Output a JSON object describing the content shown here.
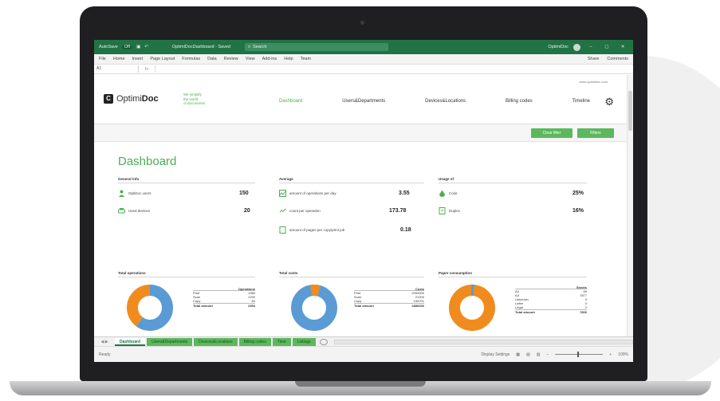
{
  "titlebar": {
    "autosave": "AutoSave",
    "autosave_state": "Off",
    "doc_title": "OptimiDocDashboard - Saved",
    "search_placeholder": "Search",
    "user": "OptimiDoc",
    "minimize": "–",
    "restore": "▢",
    "close": "✕"
  },
  "menubar": {
    "items": [
      "File",
      "Home",
      "Insert",
      "Page Layout",
      "Formulas",
      "Data",
      "Review",
      "View",
      "Add-ins",
      "Help",
      "Team"
    ],
    "share": "Share",
    "comments": "Comments"
  },
  "formulabar": {
    "name_box": "A1",
    "fx": "fx"
  },
  "app": {
    "brand_regular": "Optimi",
    "brand_bold": "Doc",
    "tagline": [
      "We simplify",
      "the world",
      "of documents"
    ],
    "url": "www.optimidoc.com",
    "nav": [
      "Dashboard",
      "Users&Departments",
      "Devices&Locations",
      "Billing codes",
      "Timeline"
    ],
    "btn_clear": "Clear filter",
    "btn_filters": "Filters"
  },
  "dashboard": {
    "title": "Dashboard",
    "general": {
      "heading": "General info",
      "rows": [
        {
          "label": "OptiDoc users",
          "value": "150"
        },
        {
          "label": "Used devices",
          "value": "20"
        }
      ]
    },
    "average": {
      "heading": "Average",
      "rows": [
        {
          "label": "amount of operations per day",
          "value": "3.55"
        },
        {
          "label": "count per operation",
          "value": "173.78"
        },
        {
          "label": "amount of pages per copy/print job",
          "value": "0.18"
        }
      ]
    },
    "usage": {
      "heading": "Usage of",
      "rows": [
        {
          "label": "Color",
          "value": "25%"
        },
        {
          "label": "Duplex",
          "value": "16%"
        }
      ]
    },
    "total_operations": {
      "heading": "Total operations",
      "col_header": "Operations",
      "rows": [
        {
          "label": "Print",
          "value": "1380"
        },
        {
          "label": "Scan",
          "value": "1290"
        },
        {
          "label": "Copy",
          "value": "84"
        }
      ],
      "total_label": "Total amount",
      "total_value": "2354"
    },
    "total_costs": {
      "heading": "Total costs",
      "col_header": "Costs",
      "rows": [
        {
          "label": "Print",
          "value": "2000000"
        },
        {
          "label": "Scan",
          "value": "21200"
        },
        {
          "label": "Copy",
          "value": "195701"
        }
      ],
      "total_label": "Total amount",
      "total_value": "2888330"
    },
    "paper": {
      "heading": "Paper consumption",
      "col_header": "Sheets",
      "rows": [
        {
          "label": "A3",
          "value": "59"
        },
        {
          "label": "A4",
          "value": "7877"
        },
        {
          "label": "Unknown",
          "value": "0"
        },
        {
          "label": "Letter",
          "value": "0"
        },
        {
          "label": "Legal",
          "value": "2"
        }
      ],
      "total_label": "Total amount",
      "total_value": "7800"
    }
  },
  "colors": {
    "accent": "#4caf50",
    "excel": "#217346",
    "orange": "#f08c1e",
    "blue": "#5b9bd5"
  },
  "sheets": {
    "tabs": [
      "Dashboard",
      "Users&Departments",
      "Devices&Locations",
      "Billing codes",
      "Time",
      "Listings"
    ],
    "nav": "◀ ▶"
  },
  "statusbar": {
    "ready": "Ready",
    "display": "Display Settings",
    "zoom": "100%"
  }
}
